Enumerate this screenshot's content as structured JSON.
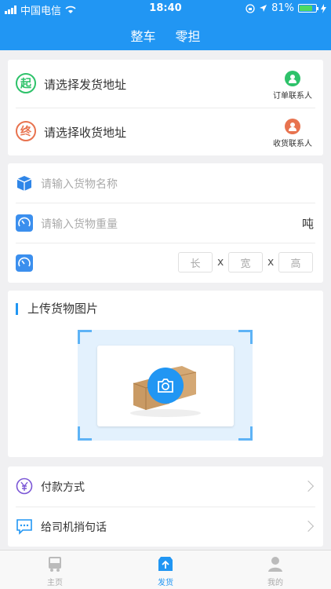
{
  "status_bar": {
    "carrier": "中国电信",
    "time": "18:40",
    "battery": "81%",
    "battery_level": 0.81
  },
  "header": {
    "tabs": [
      "整车",
      "零担"
    ]
  },
  "address": {
    "from": {
      "badge": "起",
      "label": "请选择发货地址",
      "contact": "订单联系人",
      "color": "#2ec26a"
    },
    "to": {
      "badge": "终",
      "label": "请选择收货地址",
      "contact": "收货联系人",
      "color": "#e8734f"
    }
  },
  "goods": {
    "name_placeholder": "请输入货物名称",
    "weight_placeholder": "请输入货物重量",
    "weight_unit": "吨",
    "length": "长",
    "width": "宽",
    "height": "高",
    "times": "x"
  },
  "upload": {
    "title": "上传货物图片"
  },
  "options": {
    "payment": "付款方式",
    "message": "给司机捎句话"
  },
  "bottom_nav": {
    "home": "主页",
    "ship": "发货",
    "mine": "我的"
  },
  "colors": {
    "primary": "#2196f3",
    "purple": "#7b57d6"
  }
}
